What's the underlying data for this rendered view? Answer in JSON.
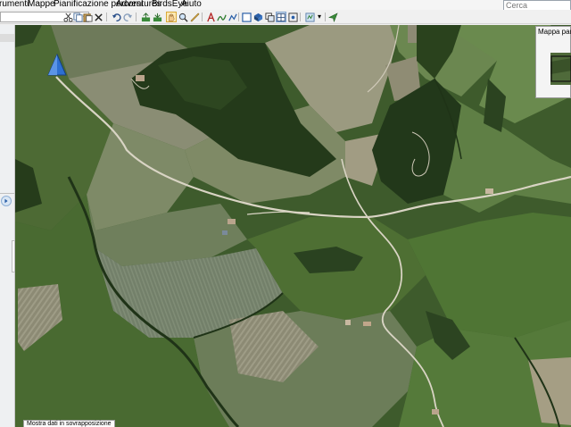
{
  "menu": [
    "rumenti",
    "Mappe",
    "Pianificazione percorsi",
    "Adventures",
    "BirdsEye",
    "Aiuto"
  ],
  "search": {
    "placeholder": "Cerca"
  },
  "overview": {
    "title": "Mappa panor"
  },
  "tooltip": {
    "text": "Mostra dati in sovrapposizione"
  },
  "icons": {
    "toolbar": [
      "cut-icon",
      "copy-icon",
      "paste-icon",
      "delete-icon",
      "undo-icon",
      "redo-icon",
      "send-to-device-icon",
      "receive-from-device-icon",
      "hand-pan-icon",
      "zoom-icon",
      "measure-icon",
      "text-tool-icon",
      "track-tool-icon",
      "route-tool-icon",
      "select-area-icon",
      "map-3d-icon",
      "layers-icon",
      "grid-icon",
      "center-icon",
      "map-settings-icon",
      "dropdown-icon",
      "navigate-icon"
    ],
    "map": [
      "position-marker-icon"
    ]
  },
  "colors": {
    "menubar": "#f5f5f5",
    "toolbar": "#f0f0f0",
    "marker": "#2d6fd1"
  }
}
